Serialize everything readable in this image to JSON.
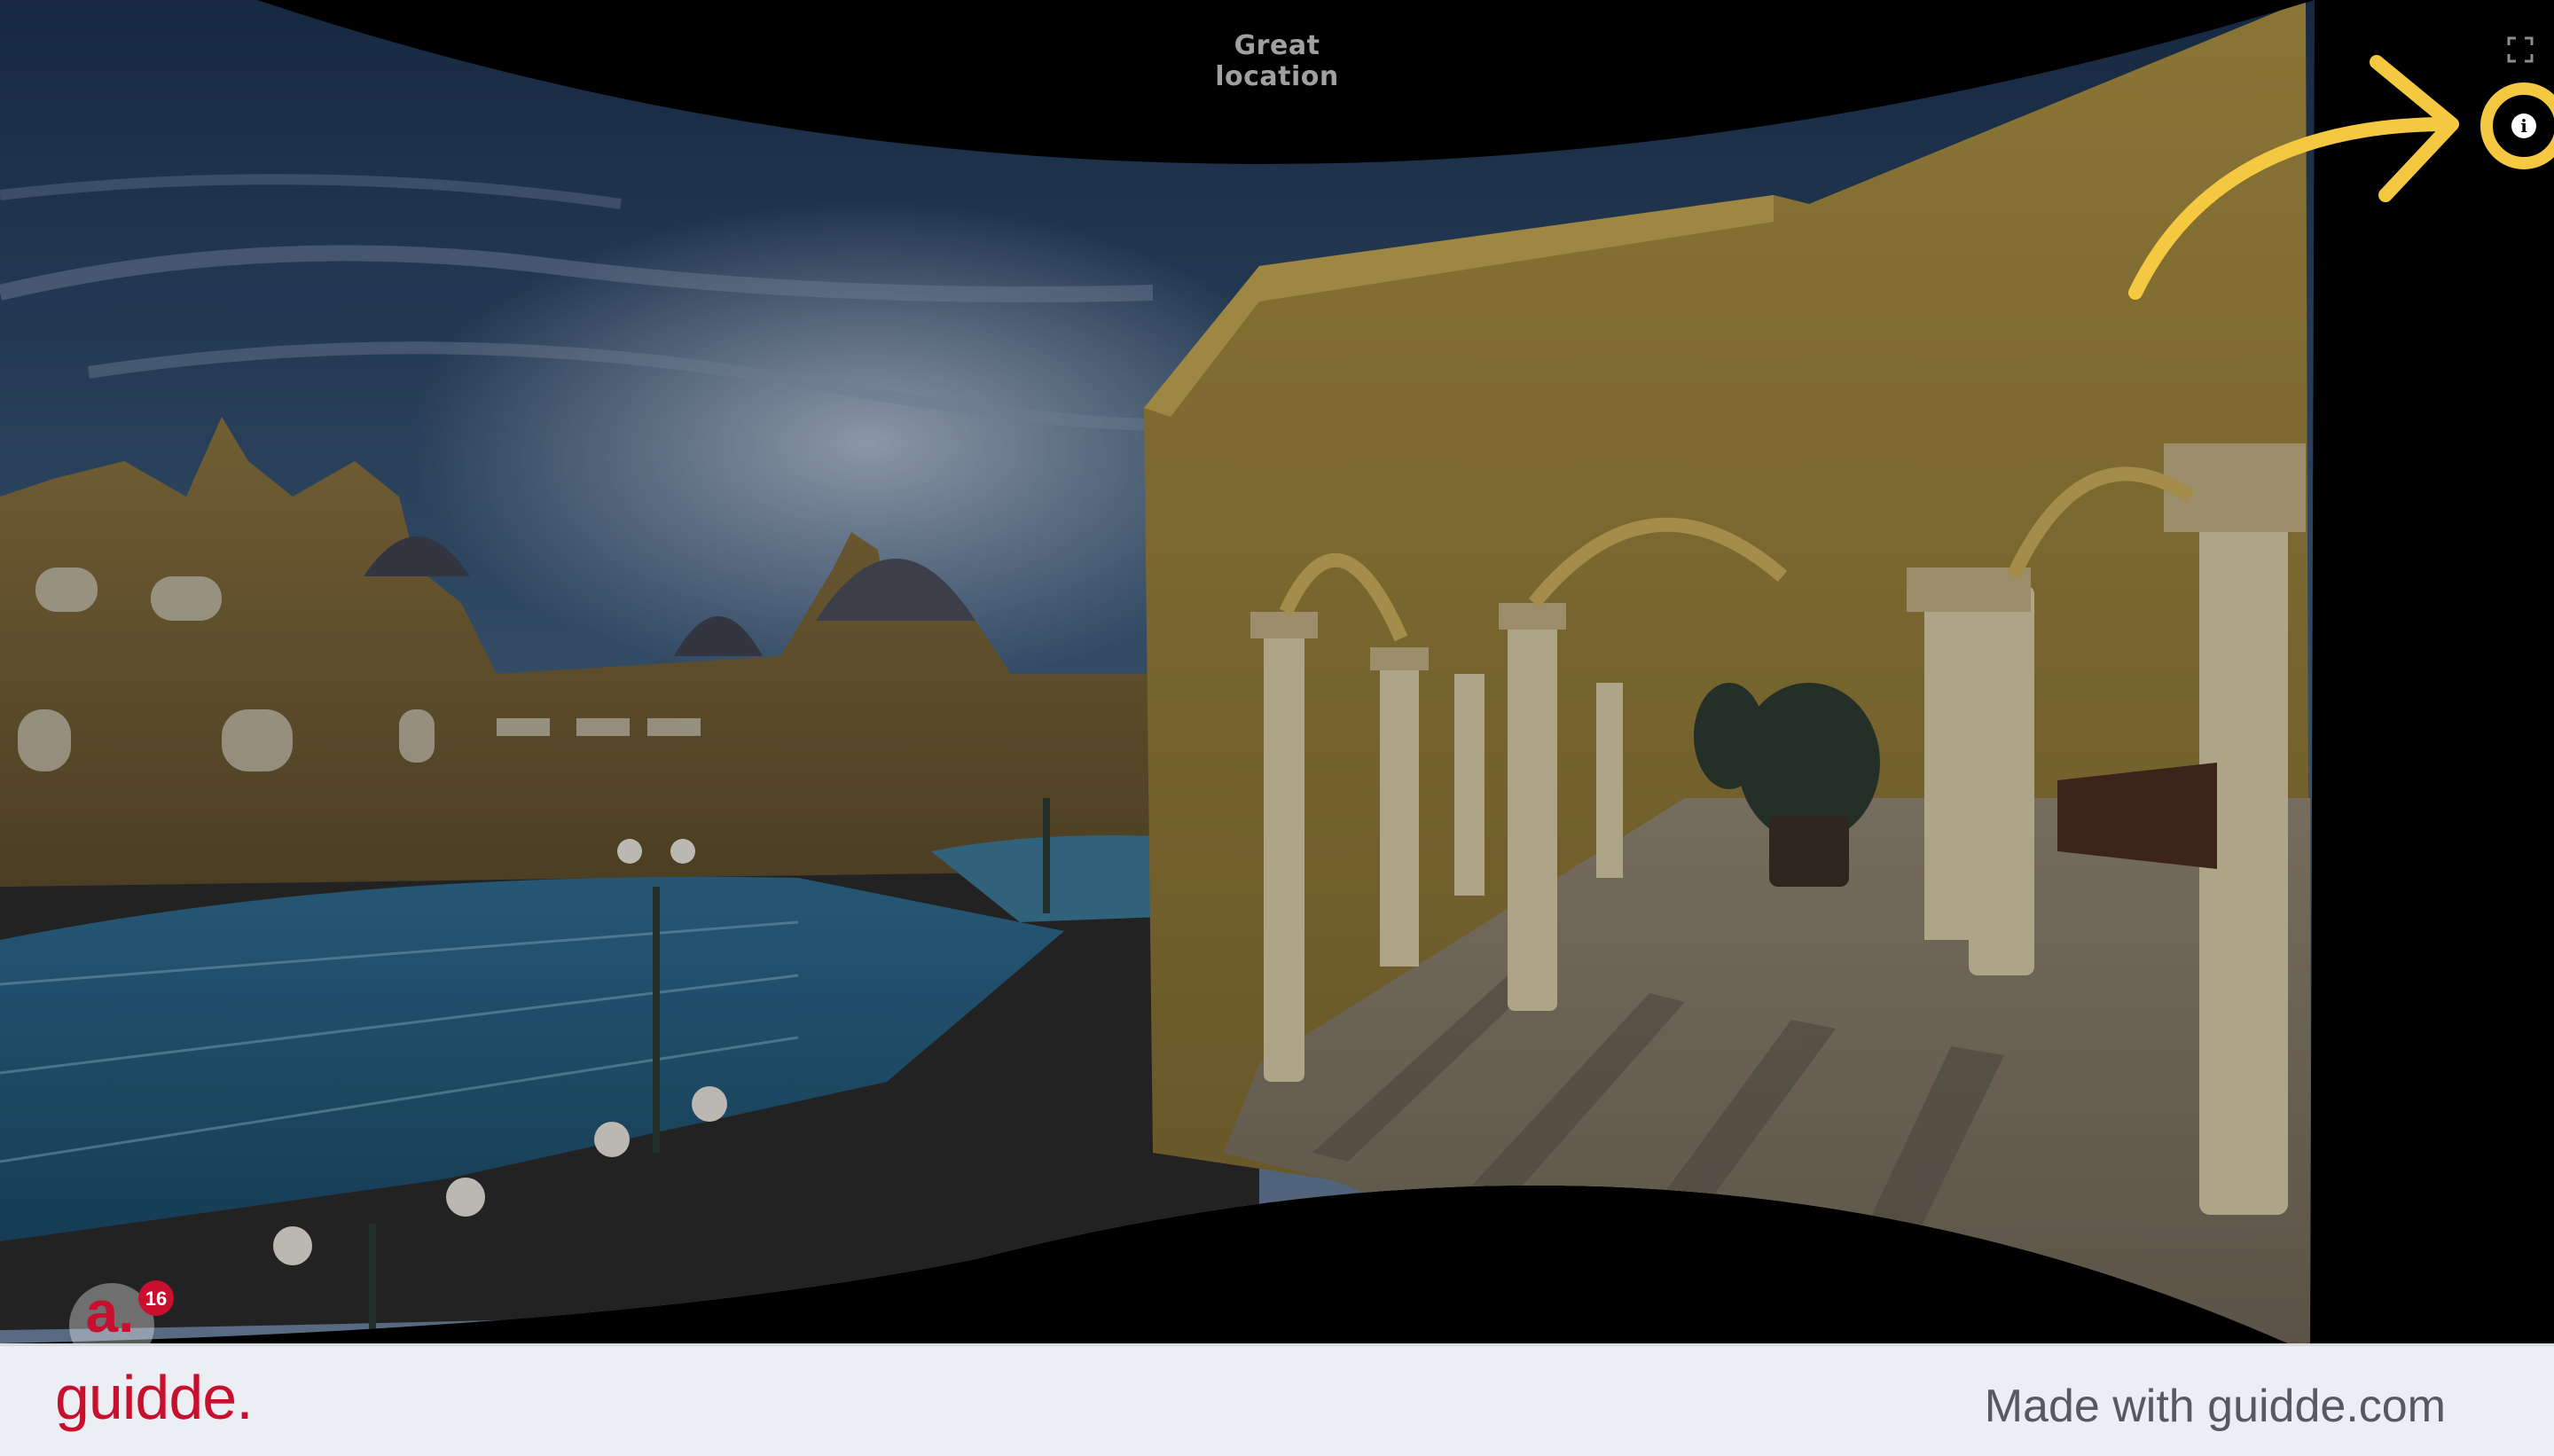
{
  "viewer": {
    "title": "Great location"
  },
  "controls": {
    "fullscreen_icon": "fullscreen-icon",
    "info_icon": "info-icon",
    "info_glyph": "i"
  },
  "annotation": {
    "arrow_color": "#f5c842"
  },
  "badge": {
    "letter": "a.",
    "count": "16"
  },
  "footer": {
    "brand": "guidde.",
    "made_with": "Made with guidde.com",
    "brand_color": "#c8102e"
  }
}
